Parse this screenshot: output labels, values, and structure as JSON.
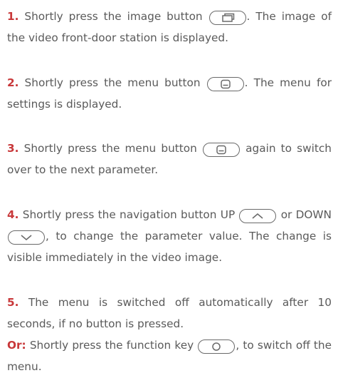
{
  "steps": [
    {
      "num": "1.",
      "text_a": " Shortly press the image button ",
      "text_b": ". The image of the video front-door station is displayed.",
      "icon": "image-button-icon"
    },
    {
      "num": "2.",
      "text_a": " Shortly press the menu button ",
      "text_b": ". The menu for settings is displayed.",
      "icon": "menu-button-icon"
    },
    {
      "num": "3.",
      "text_a": " Shortly press the menu button ",
      "text_b": " again to switch over to the next parameter.",
      "icon": "menu-button-icon"
    },
    {
      "num": "4.",
      "text_a": " Shortly press the navigation button UP ",
      "text_b": " or DOWN ",
      "text_c": ", to change the parameter value. The change is visible immediately in the video image.",
      "icons": [
        "up-button-icon",
        "down-button-icon"
      ]
    },
    {
      "num": "5.",
      "text_a": " The menu is switched off automatically after 10 seconds, if no button is pressed.",
      "or_label": "Or:",
      "text_b": " Shortly press the function key ",
      "text_c": ", to switch off the menu.",
      "icon": "function-key-icon"
    }
  ],
  "colors": {
    "accent": "#c8383a",
    "text": "#5a5a5a",
    "icon_stroke": "#6a6a6a"
  }
}
